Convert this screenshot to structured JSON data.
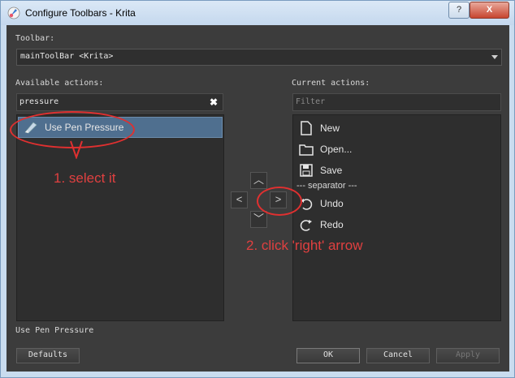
{
  "window": {
    "title": "Configure Toolbars - Krita",
    "help_glyph": "?",
    "close_glyph": "X"
  },
  "toolbar_label": "Toolbar:",
  "toolbar_value": "mainToolBar <Krita>",
  "available": {
    "label": "Available actions:",
    "search_value": "pressure",
    "clear_glyph": "✖",
    "items": [
      {
        "label": "Use Pen Pressure",
        "icon": "pen-pressure-icon",
        "selected": true
      }
    ]
  },
  "current": {
    "label": "Current actions:",
    "filter_placeholder": "Filter",
    "items": [
      {
        "label": "New",
        "icon": "new-document-icon"
      },
      {
        "label": "Open...",
        "icon": "folder-open-icon"
      },
      {
        "label": "Save",
        "icon": "save-disk-icon"
      },
      {
        "label": "--- separator ---",
        "icon": "separator"
      },
      {
        "label": "Undo",
        "icon": "undo-icon"
      },
      {
        "label": "Redo",
        "icon": "redo-icon"
      }
    ]
  },
  "arrows": {
    "up": "︿",
    "left": "<",
    "right": ">",
    "down": "﹀"
  },
  "description": "Use Pen Pressure",
  "buttons": {
    "defaults": "Defaults",
    "ok": "OK",
    "cancel": "Cancel",
    "apply": "Apply"
  },
  "annotations": {
    "step1": "1. select it",
    "step2": "2. click 'right' arrow",
    "color": "#e04040"
  }
}
